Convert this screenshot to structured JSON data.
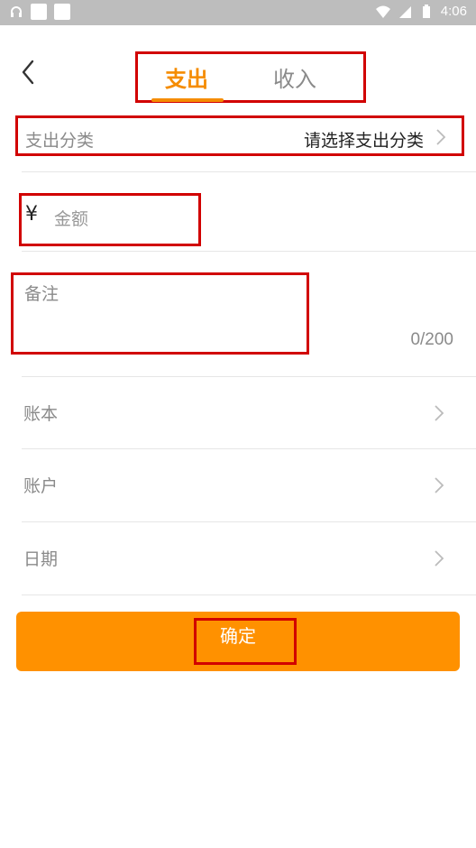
{
  "status_bar": {
    "time": "4:06",
    "icons": [
      "headset-icon",
      "app-square-icon",
      "app-square-icon",
      "wifi-icon",
      "signal-icon",
      "battery-icon"
    ]
  },
  "header": {
    "tabs": [
      {
        "label": "支出",
        "selected": true
      },
      {
        "label": "收入",
        "selected": false
      }
    ],
    "accent_color": "#f58c00"
  },
  "form": {
    "category": {
      "label": "支出分类",
      "value": "请选择支出分类"
    },
    "amount": {
      "currency": "¥",
      "placeholder": "金额"
    },
    "note": {
      "placeholder": "备注",
      "counter": "0/200"
    },
    "rows": [
      {
        "label": "账本"
      },
      {
        "label": "账户"
      },
      {
        "label": "日期"
      }
    ]
  },
  "confirm_button": {
    "label": "确定",
    "color": "#ff9100"
  }
}
